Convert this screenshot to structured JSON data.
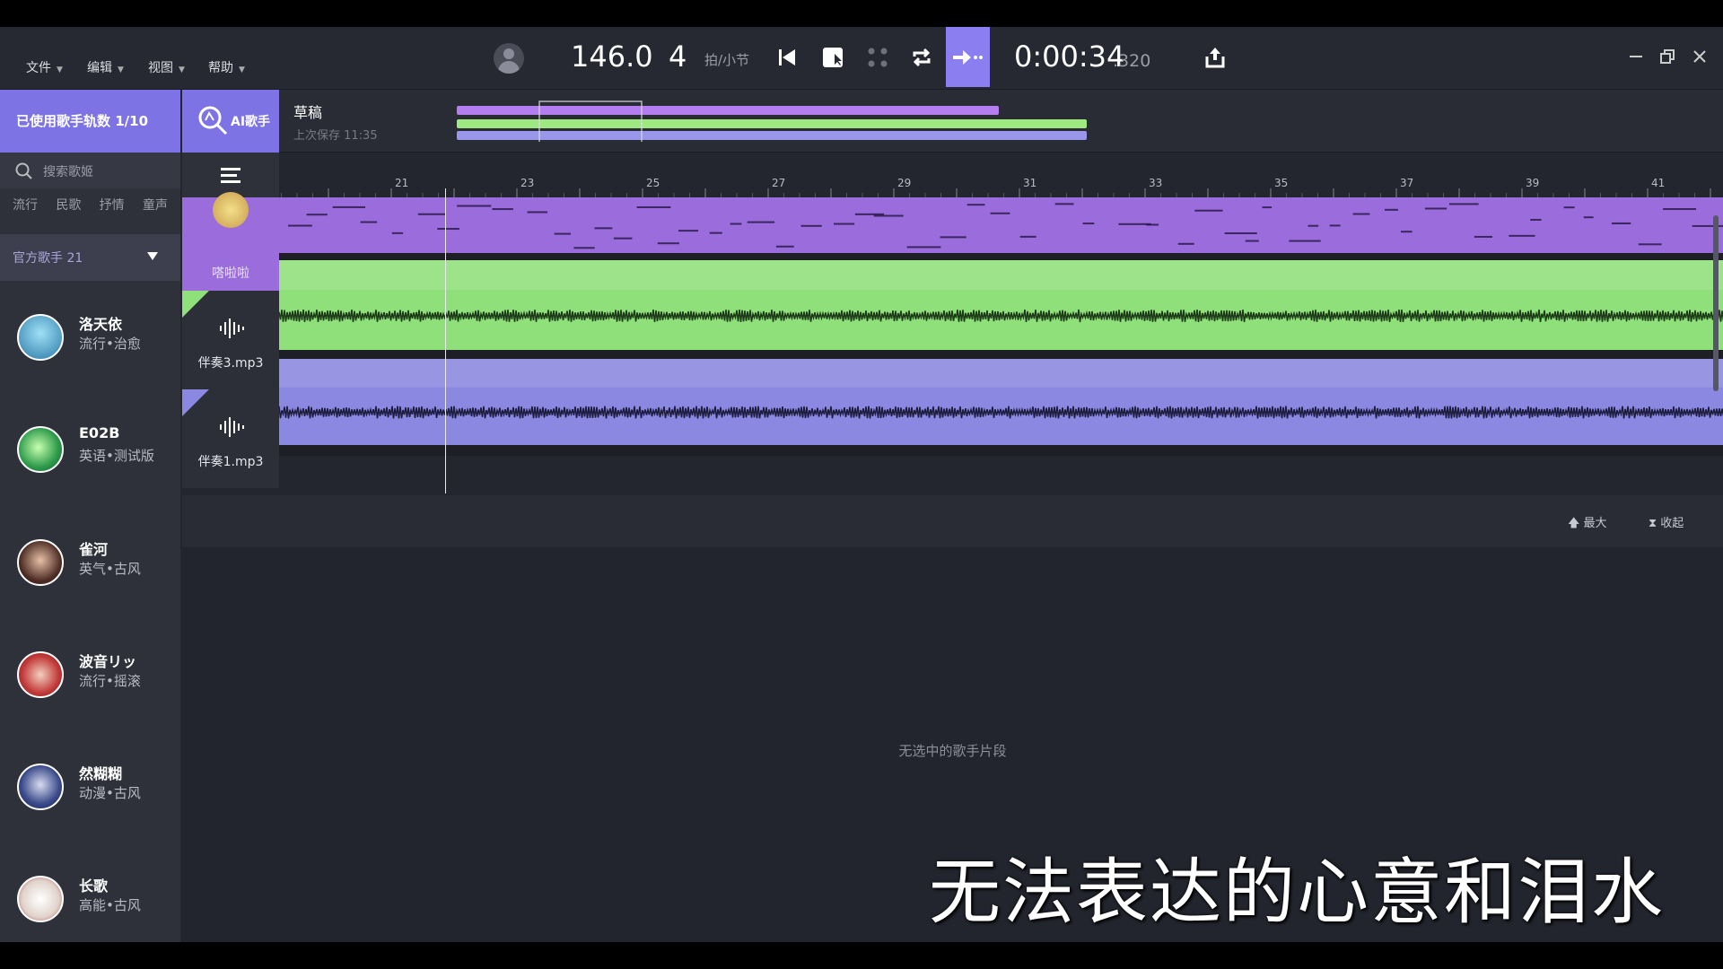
{
  "menu": [
    {
      "label": "文件"
    },
    {
      "label": "编辑"
    },
    {
      "label": "视图"
    },
    {
      "label": "帮助"
    }
  ],
  "transport": {
    "tempo": "146.0",
    "beats": "4",
    "beat_unit": "拍/小节",
    "time": "0:00:34",
    "time_ms": ".320"
  },
  "sidebar": {
    "usage": "已使用歌手轨数 1/10",
    "search_placeholder": "搜索歌姬",
    "genres": [
      "流行",
      "民歌",
      "抒情",
      "童声"
    ],
    "official": "官方歌手 21",
    "singers": [
      {
        "name": "洛天依",
        "tags": "流行•治愈",
        "color": "#5fb4d8"
      },
      {
        "name": "E02B",
        "tags": "英语•测试版",
        "color": "#3fbf6a"
      },
      {
        "name": "雀河",
        "tags": "英气•古风",
        "color": "#6a4a3a"
      },
      {
        "name": "波音リッ",
        "tags": "流行•摇滚",
        "color": "#c23a3a"
      },
      {
        "name": "然糊糊",
        "tags": "动漫•古风",
        "color": "#5a6aa8"
      },
      {
        "name": "长歌",
        "tags": "高能•古风",
        "color": "#e8e0d8"
      }
    ]
  },
  "ai_button": "AI歌手",
  "draft": {
    "title": "草稿",
    "saved": "上次保存 11:35"
  },
  "tracks": [
    {
      "label": "嗒啦啦",
      "type": "vocal",
      "color": "#9b6cdc"
    },
    {
      "label": "伴奏3.mp3",
      "type": "audio",
      "color": "#8fe07a"
    },
    {
      "label": "伴奏1.mp3",
      "type": "audio",
      "color": "#8a88e0"
    }
  ],
  "ruler_labels": [
    "21",
    "23",
    "25",
    "27",
    "29",
    "31",
    "33",
    "35",
    "37",
    "39",
    "41"
  ],
  "panel": {
    "maximize": "最大",
    "collapse": "收起",
    "empty": "无选中的歌手片段"
  },
  "subtitle": "无法表达的心意和泪水",
  "colors": {
    "accent": "#7e73e4",
    "vocal": "#9b6cdc",
    "green": "#8fe07a",
    "blue": "#8a88e0"
  }
}
